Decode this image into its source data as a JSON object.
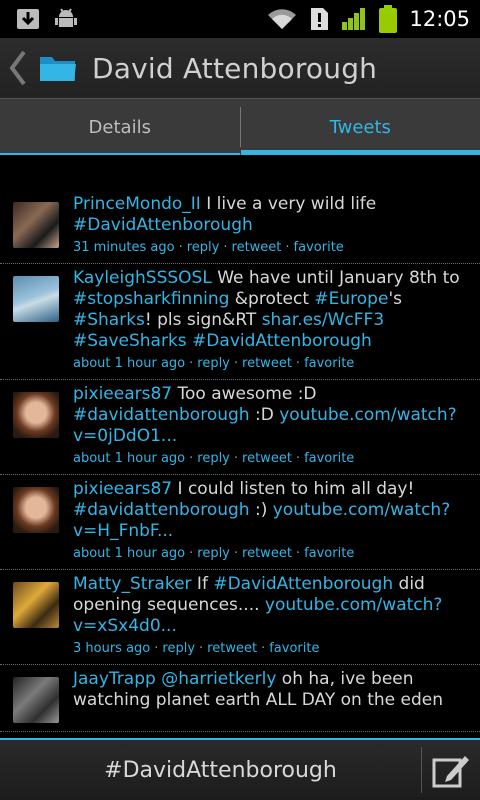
{
  "status_bar": {
    "time": "12:05",
    "icons": [
      "download-icon",
      "android-debug-icon",
      "wifi-icon",
      "alert-icon",
      "signal-icon",
      "battery-icon"
    ]
  },
  "action_bar": {
    "title": "David Attenborough",
    "back_icon": "chevron-left-icon",
    "app_icon": "folder-icon"
  },
  "tabs": [
    {
      "label": "Details",
      "active": false
    },
    {
      "label": "Tweets",
      "active": true
    }
  ],
  "accent_color": "#33b5e5",
  "tweets": [
    {
      "user": "PrinceMondo_II",
      "parts": [
        {
          "t": " I live a very wild life ",
          "link": false
        },
        {
          "t": "#DavidAttenborough",
          "link": true
        }
      ],
      "time": "31 minutes ago",
      "actions": [
        "reply",
        "retweet",
        "favorite"
      ]
    },
    {
      "user": "KayleighSSSOSL",
      "parts": [
        {
          "t": " We have until January 8th to ",
          "link": false
        },
        {
          "t": "#stopsharkfinning",
          "link": true
        },
        {
          "t": " &protect ",
          "link": false
        },
        {
          "t": "#Europe",
          "link": true
        },
        {
          "t": "'s ",
          "link": false
        },
        {
          "t": "#Sharks",
          "link": true
        },
        {
          "t": "! pls sign&RT ",
          "link": false
        },
        {
          "t": "shar.es/WcFF3",
          "link": true
        },
        {
          "t": " ",
          "link": false
        },
        {
          "t": "#SaveSharks",
          "link": true
        },
        {
          "t": " ",
          "link": false
        },
        {
          "t": "#DavidAttenborough",
          "link": true
        }
      ],
      "time": "about 1 hour ago",
      "actions": [
        "reply",
        "retweet",
        "favorite"
      ]
    },
    {
      "user": "pixieears87",
      "parts": [
        {
          "t": " Too awesome :D ",
          "link": false
        },
        {
          "t": "#davidattenborough",
          "link": true
        },
        {
          "t": " :D ",
          "link": false
        },
        {
          "t": "youtube.com/watch?v=0jDdO1...",
          "link": true
        }
      ],
      "time": "about 1 hour ago",
      "actions": [
        "reply",
        "retweet",
        "favorite"
      ]
    },
    {
      "user": "pixieears87",
      "parts": [
        {
          "t": " I could listen to him all day! ",
          "link": false
        },
        {
          "t": "#davidattenborough",
          "link": true
        },
        {
          "t": " :) ",
          "link": false
        },
        {
          "t": "youtube.com/watch?v=H_FnbF...",
          "link": true
        }
      ],
      "time": "about 1 hour ago",
      "actions": [
        "reply",
        "retweet",
        "favorite"
      ]
    },
    {
      "user": "Matty_Straker",
      "parts": [
        {
          "t": " If ",
          "link": false
        },
        {
          "t": "#DavidAttenborough",
          "link": true
        },
        {
          "t": " did opening sequences.... ",
          "link": false
        },
        {
          "t": "youtube.com/watch?v=xSx4d0...",
          "link": true
        }
      ],
      "time": "3 hours ago",
      "actions": [
        "reply",
        "retweet",
        "favorite"
      ]
    },
    {
      "user": "JaayTrapp",
      "parts": [
        {
          "t": " ",
          "link": false
        },
        {
          "t": "@harrietkerly",
          "link": true
        },
        {
          "t": " oh ha, ive been watching planet earth ALL DAY on the eden",
          "link": false
        }
      ],
      "time": "",
      "actions": []
    }
  ],
  "bottom_bar": {
    "label": "#DavidAttenborough",
    "compose_icon": "compose-icon"
  }
}
